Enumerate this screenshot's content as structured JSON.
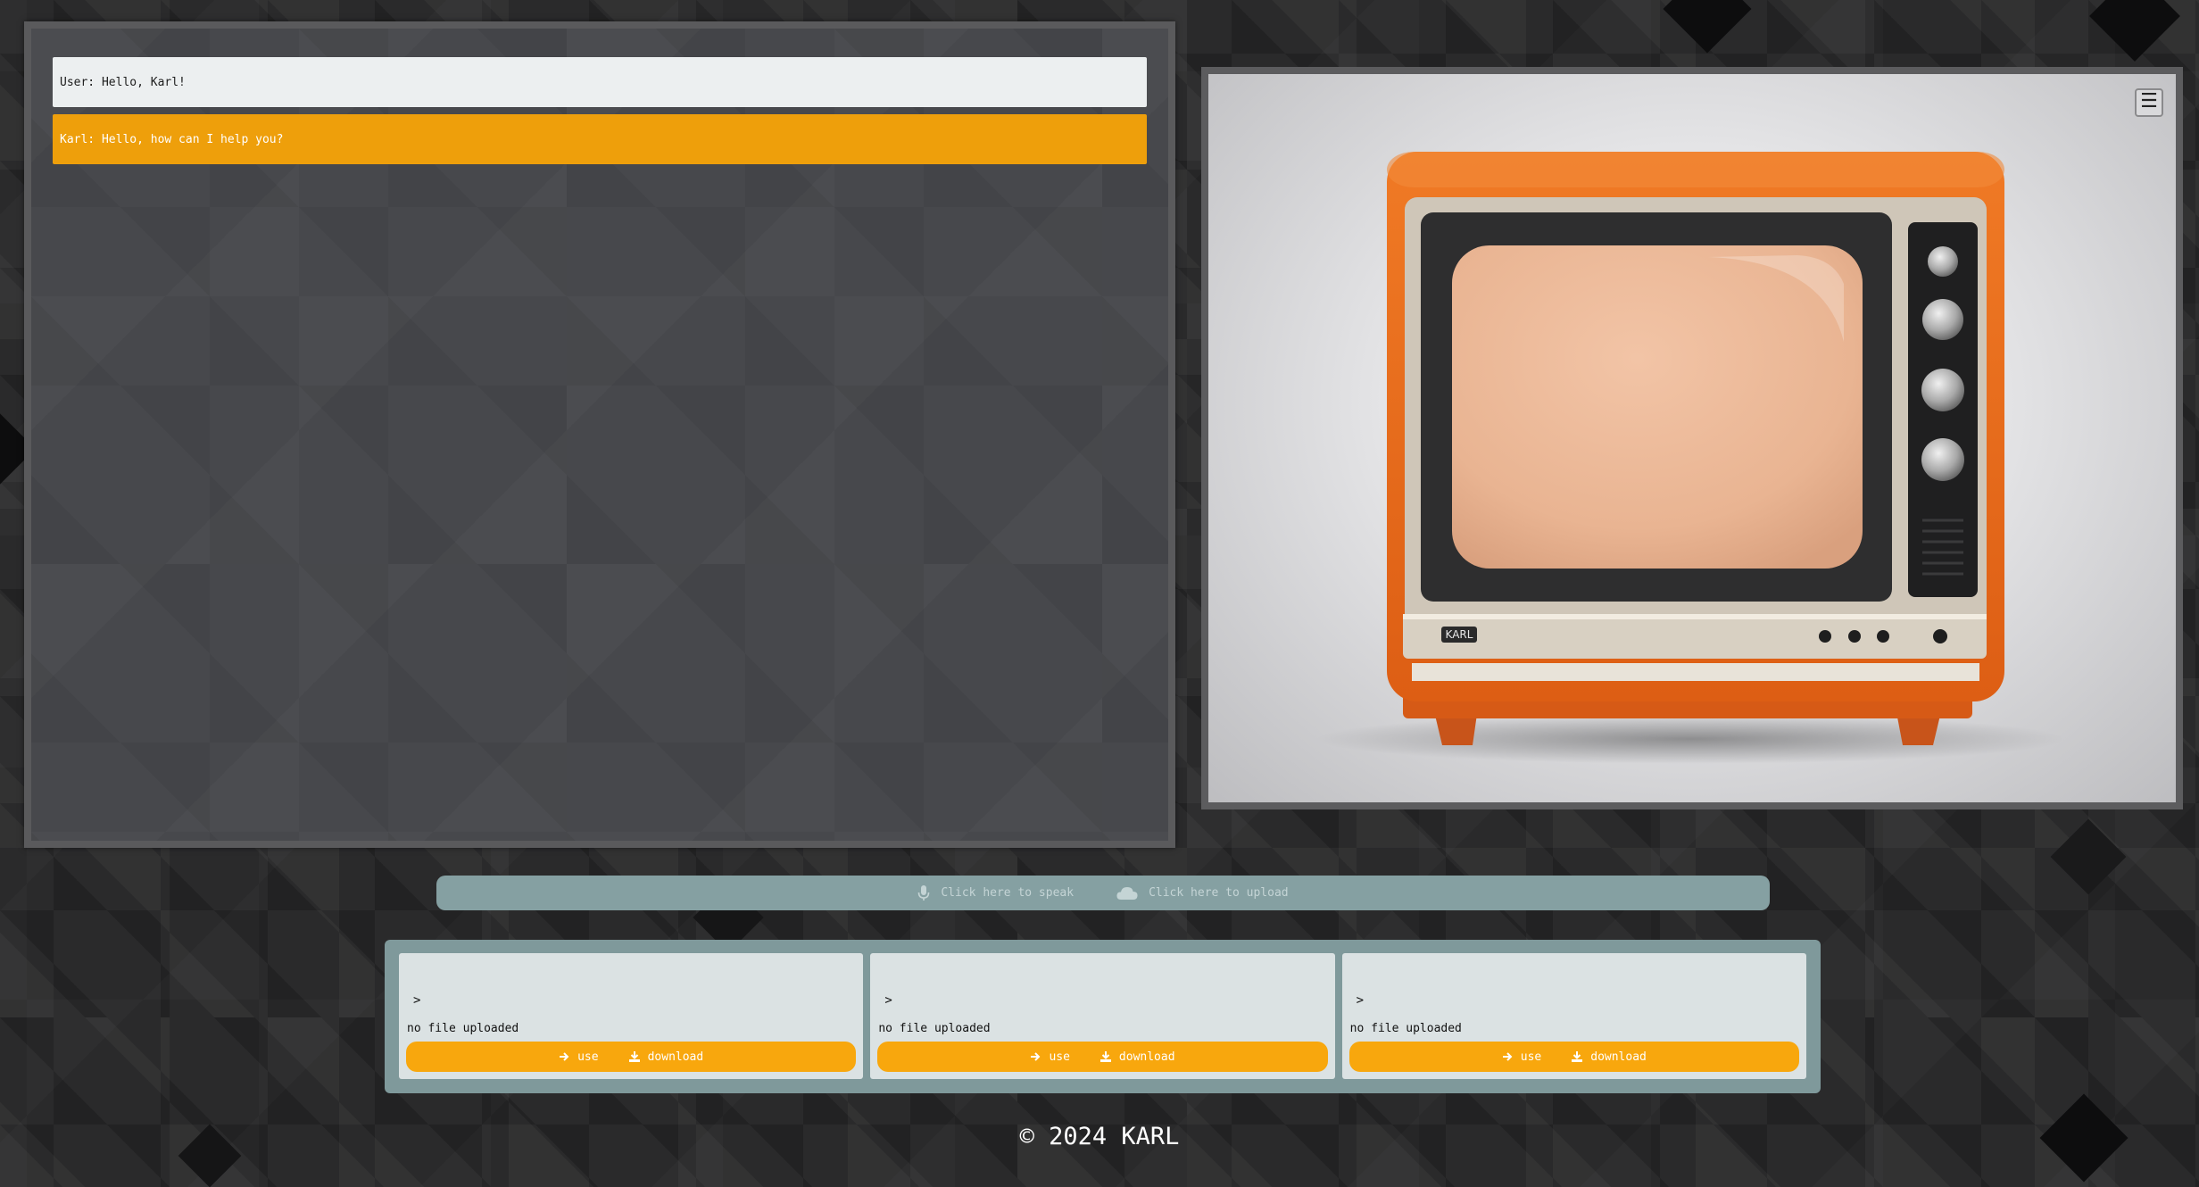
{
  "chat": {
    "messages": [
      {
        "sender": "user",
        "text": "User: Hello, Karl!"
      },
      {
        "sender": "karl",
        "text": "Karl: Hello, how can I help you?"
      }
    ]
  },
  "tv": {
    "brand_label": "KARL",
    "menu_icon": "☰"
  },
  "input_bar": {
    "speak_label": "Click here to speak",
    "upload_label": "Click here to upload",
    "speak_icon": "microphone-icon",
    "upload_icon": "cloud-upload-icon"
  },
  "files": [
    {
      "prompt": ">",
      "status": "no file uploaded",
      "use_label": "use",
      "download_label": "download"
    },
    {
      "prompt": ">",
      "status": "no file uploaded",
      "use_label": "use",
      "download_label": "download"
    },
    {
      "prompt": ">",
      "status": "no file uploaded",
      "use_label": "use",
      "download_label": "download"
    }
  ],
  "footer": {
    "text": "© 2024 KARL"
  },
  "colors": {
    "accent_orange": "#ee9f0b",
    "button_orange": "#f8a70d",
    "teal_panel": "#7f999b",
    "teal_bar": "#85a0a2",
    "user_bubble": "#eceff0",
    "tv_body": "#ea6c1d",
    "tv_screen": "#eab796"
  }
}
